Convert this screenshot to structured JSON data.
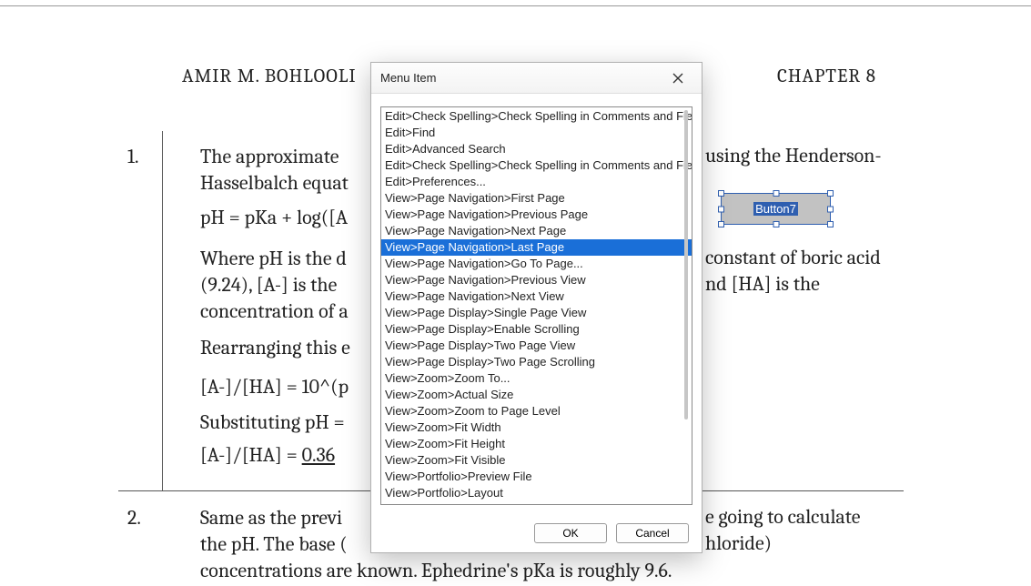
{
  "document": {
    "header_left": "AMIR M. BOHLOOLI",
    "header_right": "CHAPTER 8",
    "item1_num": "1.",
    "item2_num": "2.",
    "p1_left": "The approximate ",
    "p1_right": "using the Henderson-",
    "p1b": "Hasselbalch equat",
    "p2": "pH = pKa + log([A",
    "p3a_left": "Where pH is the d",
    "p3a_right": " constant of boric acid",
    "p3b_left": "(9.24), [A-] is the ",
    "p3b_right": "nd [HA] is the",
    "p3c": "concentration of a",
    "p4": "Rearranging this e",
    "p5": "[A-]/[HA] = 10^(p",
    "p6": "Substituting pH =",
    "p7_prefix": "[A-]/[HA] = ",
    "p7_value": "0.36",
    "p8a_left": "Same as the previ",
    "p8a_right": "e going to calculate",
    "p8b_left": "the pH. The base (",
    "p8b_right": "hloride)",
    "p8c": "concentrations are known. Ephedrine's pKa is roughly 9.6."
  },
  "formfield": {
    "label": "Button7"
  },
  "dialog": {
    "title": "Menu Item",
    "ok": "OK",
    "cancel": "Cancel",
    "selected_index": 8,
    "items": [
      "Edit>Check Spelling>Check Spelling in Comments and Fields.",
      "Edit>Find",
      "Edit>Advanced Search",
      "Edit>Check Spelling>Check Spelling in Comments and Fields.",
      "Edit>Preferences...",
      "View>Page Navigation>First Page",
      "View>Page Navigation>Previous Page",
      "View>Page Navigation>Next Page",
      "View>Page Navigation>Last Page",
      "View>Page Navigation>Go To Page...",
      "View>Page Navigation>Previous View",
      "View>Page Navigation>Next View",
      "View>Page Display>Single Page View",
      "View>Page Display>Enable Scrolling",
      "View>Page Display>Two Page View",
      "View>Page Display>Two Page Scrolling",
      "View>Zoom>Zoom To...",
      "View>Zoom>Actual Size",
      "View>Zoom>Zoom to Page Level",
      "View>Zoom>Fit Width",
      "View>Zoom>Fit Height",
      "View>Zoom>Fit Visible",
      "View>Portfolio>Preview File",
      "View>Portfolio>Layout"
    ]
  }
}
